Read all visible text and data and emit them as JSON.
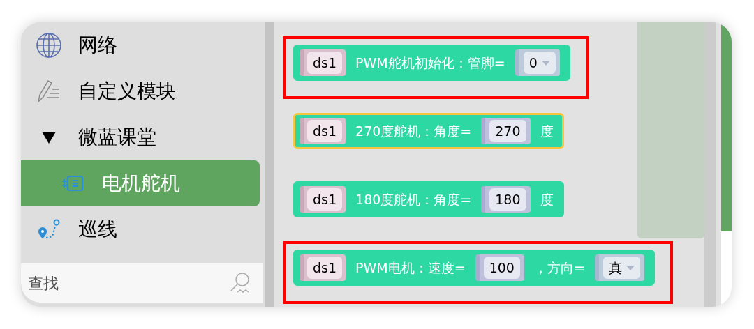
{
  "sidebar": {
    "items": [
      {
        "kind": "globe",
        "label": "网络",
        "selected": false
      },
      {
        "kind": "pencil",
        "label": "自定义模块",
        "selected": false
      },
      {
        "kind": "category",
        "label": "微蓝课堂",
        "expanded": true,
        "selected": false
      },
      {
        "kind": "motor",
        "label": "电机舵机",
        "selected": true
      },
      {
        "kind": "route",
        "label": "巡线",
        "selected": false
      }
    ],
    "search": {
      "placeholder": "查找"
    }
  },
  "blocks": [
    {
      "outlined": true,
      "selected": false,
      "parts": [
        {
          "kind": "variable",
          "text": "ds1"
        },
        {
          "kind": "label",
          "text": "PWM舵机初始化：管脚="
        },
        {
          "kind": "dropdown",
          "text": "0"
        }
      ]
    },
    {
      "outlined": false,
      "selected": true,
      "parts": [
        {
          "kind": "variable",
          "text": "ds1"
        },
        {
          "kind": "label",
          "text": "270度舵机：角度="
        },
        {
          "kind": "number",
          "text": "270"
        },
        {
          "kind": "label",
          "text": "度"
        }
      ]
    },
    {
      "outlined": false,
      "selected": false,
      "parts": [
        {
          "kind": "variable",
          "text": "ds1"
        },
        {
          "kind": "label",
          "text": "180度舵机：角度="
        },
        {
          "kind": "number",
          "text": "180"
        },
        {
          "kind": "label",
          "text": "度"
        }
      ]
    },
    {
      "outlined": true,
      "selected": false,
      "parts": [
        {
          "kind": "variable",
          "text": "ds1"
        },
        {
          "kind": "label",
          "text": "PWM电机：速度="
        },
        {
          "kind": "number",
          "text": "100"
        },
        {
          "kind": "label",
          "text": "，方向="
        },
        {
          "kind": "dropdown",
          "text": "真"
        }
      ]
    }
  ]
}
